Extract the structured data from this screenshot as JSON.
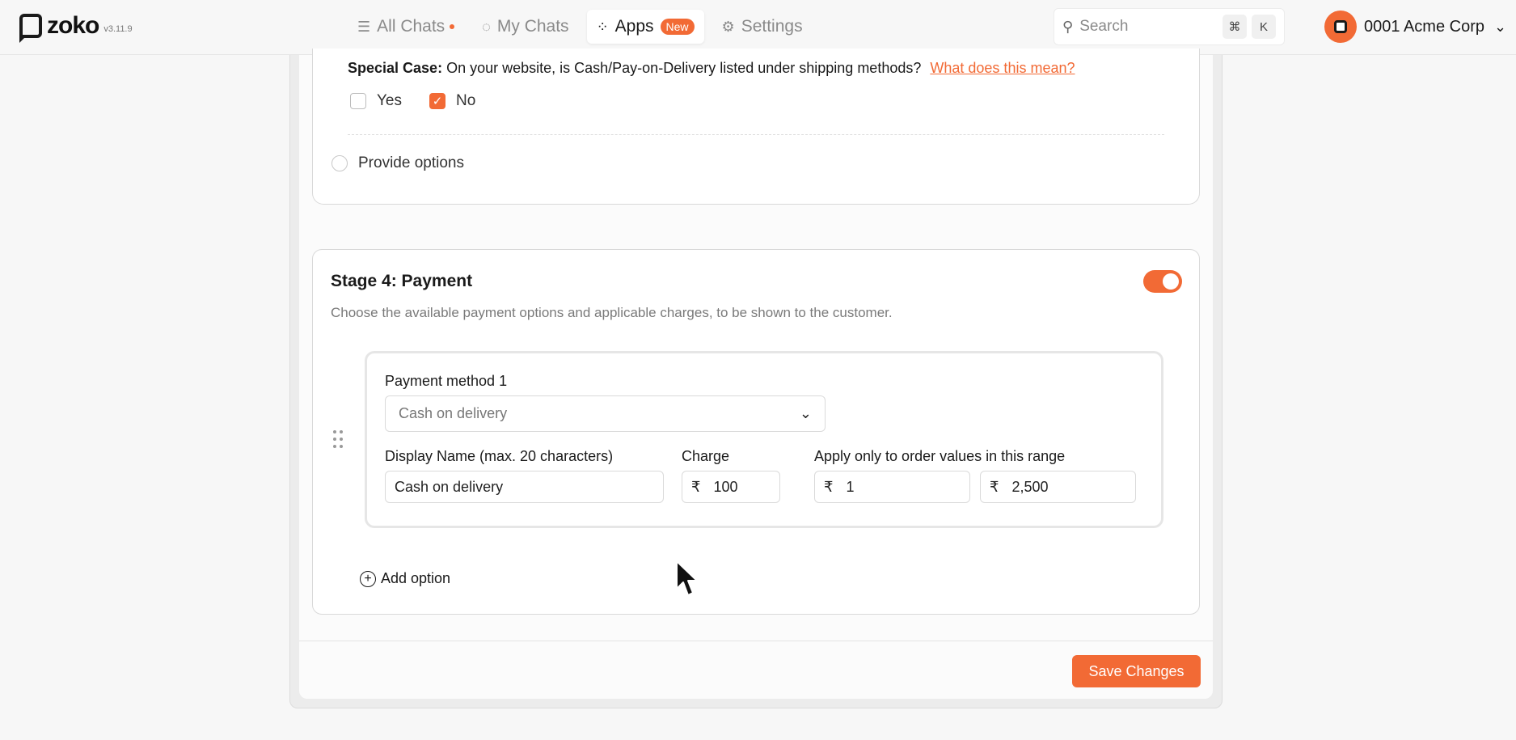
{
  "brand": {
    "name": "zoko",
    "version": "v3.11.9"
  },
  "nav": {
    "items": [
      {
        "label": "All Chats",
        "icon": "list-icon",
        "dot": true
      },
      {
        "label": "My Chats",
        "icon": "chat-icon"
      },
      {
        "label": "Apps",
        "icon": "apps-grid-icon",
        "badge": "New",
        "active": true
      },
      {
        "label": "Settings",
        "icon": "gear-icon"
      }
    ]
  },
  "search": {
    "placeholder": "Search",
    "shortcut_cmd": "⌘",
    "shortcut_key": "K"
  },
  "account": {
    "name": "0001 Acme Corp"
  },
  "special_case": {
    "label": "Special Case:",
    "question": "On your website, is Cash/Pay-on-Delivery listed under shipping methods?",
    "link": "What does this mean?",
    "options": [
      {
        "label": "Yes",
        "checked": false
      },
      {
        "label": "No",
        "checked": true
      }
    ]
  },
  "provide_options": {
    "label": "Provide options",
    "selected": false
  },
  "stage4": {
    "title": "Stage 4: Payment",
    "enabled": true,
    "description": "Choose the available payment options and applicable charges, to be shown to the customer.",
    "method": {
      "label": "Payment method 1",
      "selected": "Cash on delivery",
      "display_name_label": "Display Name (max. 20 characters)",
      "display_name_value": "Cash on delivery",
      "charge_label": "Charge",
      "currency": "₹",
      "charge_value": "100",
      "range_label": "Apply only to order values in this range",
      "range_min": "1",
      "range_max": "2,500"
    },
    "add_option": "Add option"
  },
  "footer": {
    "save_label": "Save Changes"
  },
  "colors": {
    "accent": "#f26a35"
  }
}
